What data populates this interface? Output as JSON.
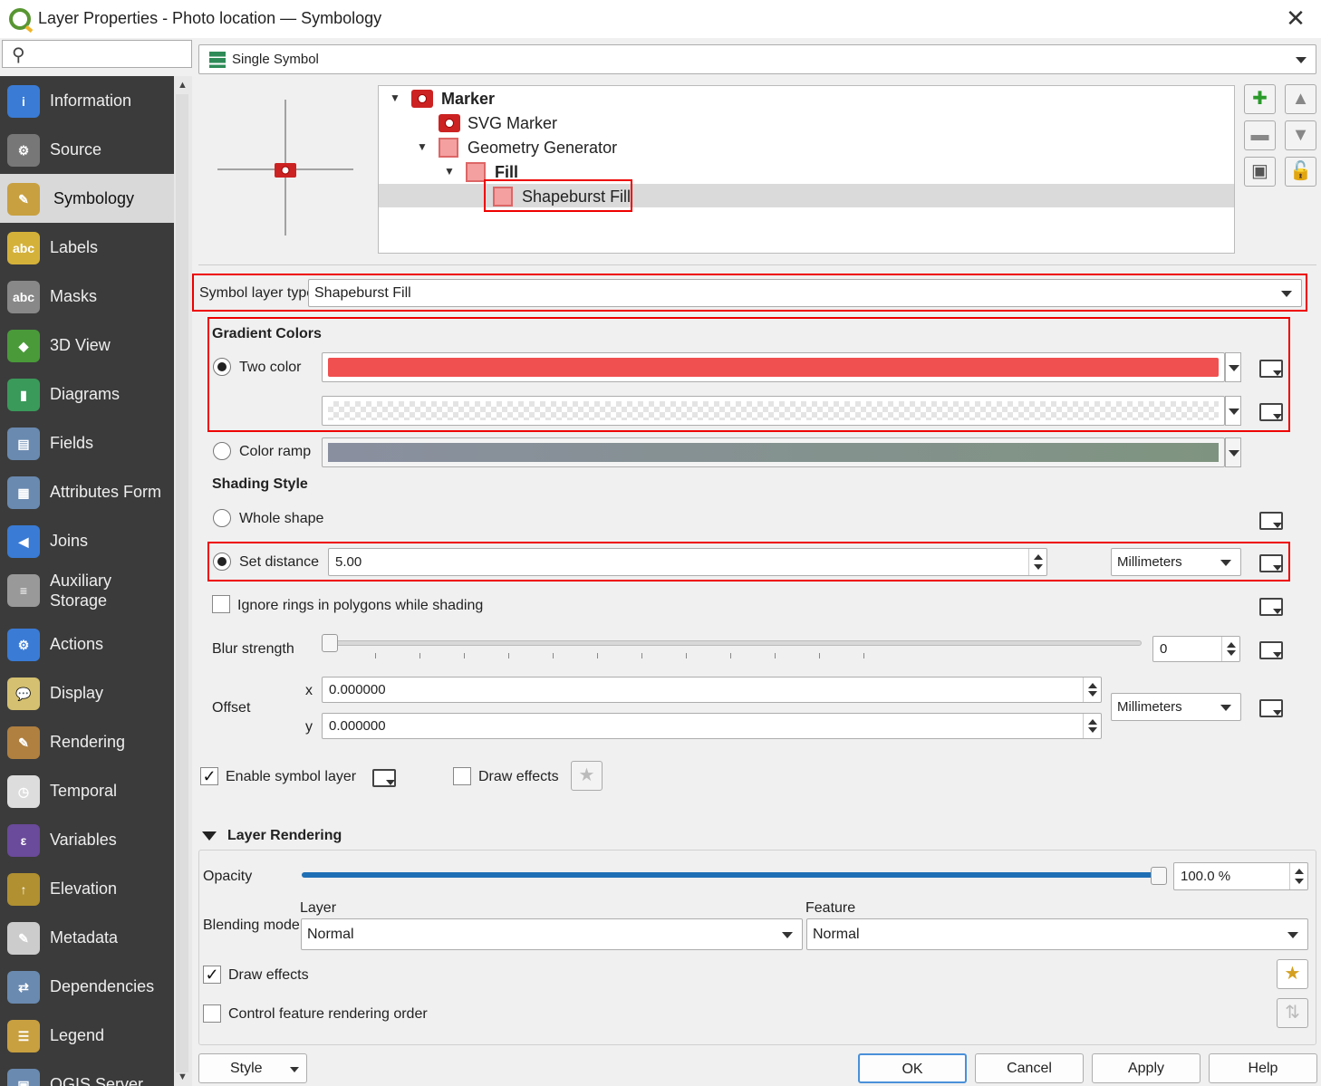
{
  "window": {
    "title": "Layer Properties - Photo location — Symbology",
    "close": "✕"
  },
  "sidebar": {
    "items": [
      {
        "label": "Information",
        "icon": "information-icon",
        "color": "#3a7bd5",
        "glyph": "i"
      },
      {
        "label": "Source",
        "icon": "source-icon",
        "color": "#777",
        "glyph": "⚙"
      },
      {
        "label": "Symbology",
        "icon": "symbology-icon",
        "color": "#c8a040",
        "glyph": "✎"
      },
      {
        "label": "Labels",
        "icon": "labels-icon",
        "color": "#d4b23a",
        "glyph": "abc"
      },
      {
        "label": "Masks",
        "icon": "masks-icon",
        "color": "#888",
        "glyph": "abc"
      },
      {
        "label": "3D View",
        "icon": "3d-view-icon",
        "color": "#4a9a3a",
        "glyph": "◆"
      },
      {
        "label": "Diagrams",
        "icon": "diagrams-icon",
        "color": "#3a9a5a",
        "glyph": "▮"
      },
      {
        "label": "Fields",
        "icon": "fields-icon",
        "color": "#6a8ab0",
        "glyph": "▤"
      },
      {
        "label": "Attributes Form",
        "icon": "attributes-form-icon",
        "color": "#6a8ab0",
        "glyph": "▦"
      },
      {
        "label": "Joins",
        "icon": "joins-icon",
        "color": "#3a7bd5",
        "glyph": "◀"
      },
      {
        "label": "Auxiliary Storage",
        "icon": "auxiliary-storage-icon",
        "color": "#999",
        "glyph": "≡"
      },
      {
        "label": "Actions",
        "icon": "actions-icon",
        "color": "#3a7bd5",
        "glyph": "⚙"
      },
      {
        "label": "Display",
        "icon": "display-icon",
        "color": "#d4c070",
        "glyph": "💬"
      },
      {
        "label": "Rendering",
        "icon": "rendering-icon",
        "color": "#b08040",
        "glyph": "✎"
      },
      {
        "label": "Temporal",
        "icon": "temporal-icon",
        "color": "#ddd",
        "glyph": "◷"
      },
      {
        "label": "Variables",
        "icon": "variables-icon",
        "color": "#6a4a9a",
        "glyph": "ε"
      },
      {
        "label": "Elevation",
        "icon": "elevation-icon",
        "color": "#b09030",
        "glyph": "↑"
      },
      {
        "label": "Metadata",
        "icon": "metadata-icon",
        "color": "#ccc",
        "glyph": "✎"
      },
      {
        "label": "Dependencies",
        "icon": "dependencies-icon",
        "color": "#6a8ab0",
        "glyph": "⇄"
      },
      {
        "label": "Legend",
        "icon": "legend-icon",
        "color": "#c8a040",
        "glyph": "☰"
      },
      {
        "label": "QGIS Server",
        "icon": "qgis-server-icon",
        "color": "#6a8ab0",
        "glyph": "▣"
      }
    ]
  },
  "renderer": {
    "label": "Single Symbol"
  },
  "tree": {
    "marker": "Marker",
    "svg_marker": "SVG Marker",
    "geometry_generator": "Geometry Generator",
    "fill": "Fill",
    "shapeburst": "Shapeburst Fill"
  },
  "symbol_layer_type": {
    "label": "Symbol layer type",
    "value": "Shapeburst Fill"
  },
  "gradient": {
    "heading": "Gradient Colors",
    "two_color": "Two color",
    "color_ramp": "Color ramp",
    "color1": "#f05050"
  },
  "shading": {
    "heading": "Shading Style",
    "whole_shape": "Whole shape",
    "set_distance": "Set distance",
    "distance_value": "5.00",
    "distance_unit": "Millimeters",
    "ignore_rings": "Ignore rings in polygons while shading"
  },
  "blur": {
    "label": "Blur strength",
    "value": "0",
    "level": 0
  },
  "offset": {
    "label": "Offset",
    "x_label": "x",
    "y_label": "y",
    "x": "0.000000",
    "y": "0.000000",
    "unit": "Millimeters"
  },
  "layer_options": {
    "enable": "Enable symbol layer",
    "draw_effects": "Draw effects"
  },
  "layer_rendering": {
    "heading": "Layer Rendering",
    "opacity_label": "Opacity",
    "opacity_value": "100.0 %",
    "opacity_level": 1.0,
    "blending_label": "Blending mode",
    "layer_label": "Layer",
    "feature_label": "Feature",
    "layer_mode": "Normal",
    "feature_mode": "Normal",
    "draw_effects": "Draw effects",
    "control_order": "Control feature rendering order"
  },
  "footer": {
    "style": "Style",
    "ok": "OK",
    "cancel": "Cancel",
    "apply": "Apply",
    "help": "Help"
  }
}
